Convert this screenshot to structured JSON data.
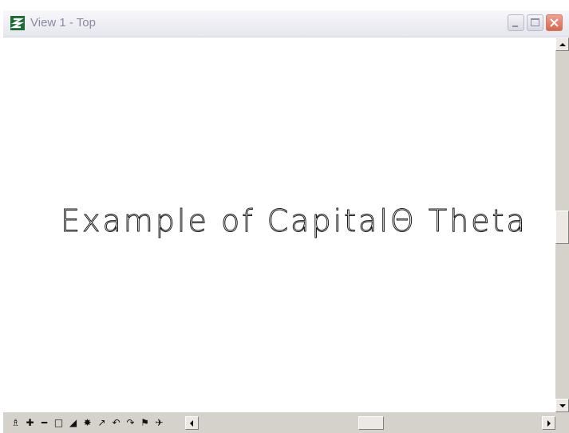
{
  "window": {
    "title": "View 1 - Top",
    "buttons": {
      "minimize": "minimize-icon",
      "maximize": "maximize-icon",
      "close": "close-icon"
    }
  },
  "canvas": {
    "text": "Example of CapitalΘ Theta"
  },
  "view_tools": [
    {
      "name": "update-view-icon",
      "glyph": "♗"
    },
    {
      "name": "zoom-in-icon",
      "glyph": "✚"
    },
    {
      "name": "zoom-out-icon",
      "glyph": "━"
    },
    {
      "name": "window-area-icon",
      "glyph": "□"
    },
    {
      "name": "fit-view-icon",
      "glyph": "◢"
    },
    {
      "name": "rotate-view-icon",
      "glyph": "✸"
    },
    {
      "name": "pan-view-icon",
      "glyph": "↗"
    },
    {
      "name": "view-previous-icon",
      "glyph": "↶"
    },
    {
      "name": "view-next-icon",
      "glyph": "↷"
    },
    {
      "name": "copy-view-icon",
      "glyph": "⚑"
    },
    {
      "name": "camera-icon",
      "glyph": "✈"
    }
  ],
  "colors": {
    "title_text": "#8a8aa2",
    "scrollbar": "#d5d2cc",
    "close_button": "#d9654f",
    "canvas_bg": "#ffffff"
  }
}
